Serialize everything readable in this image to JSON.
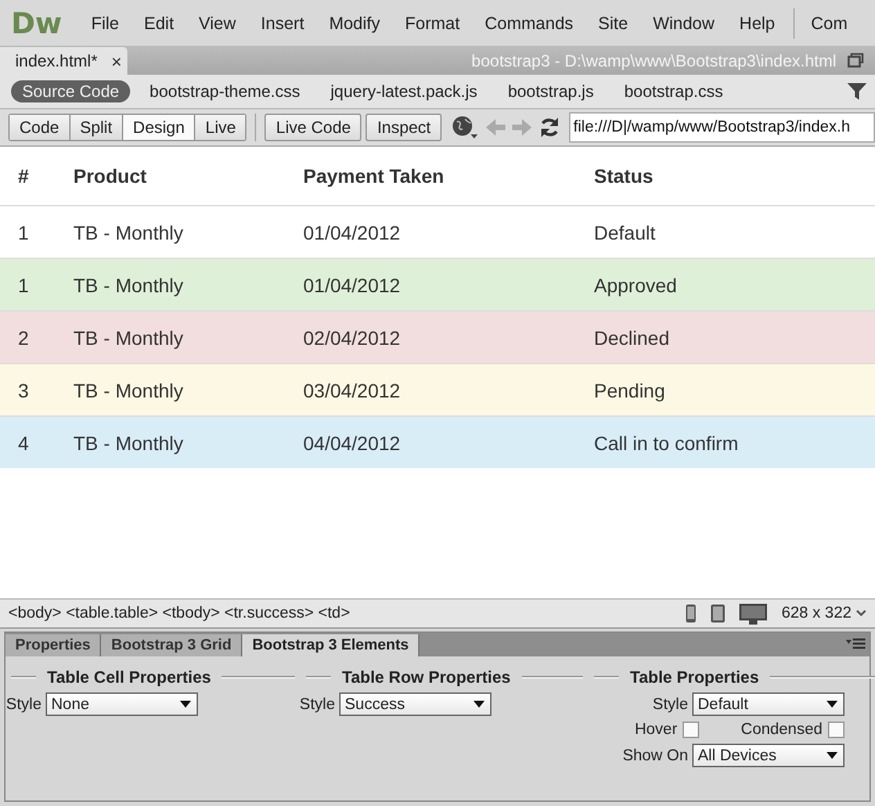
{
  "menu": {
    "logo": "Dw",
    "items": [
      "File",
      "Edit",
      "View",
      "Insert",
      "Modify",
      "Format",
      "Commands",
      "Site",
      "Window",
      "Help"
    ],
    "overflow": "Com"
  },
  "document_tab": {
    "title": "index.html*",
    "close": "×",
    "path": "bootstrap3 - D:\\wamp\\www\\Bootstrap3\\index.html"
  },
  "related_files": [
    {
      "label": "Source Code",
      "selected": true
    },
    {
      "label": "bootstrap-theme.css",
      "selected": false
    },
    {
      "label": "jquery-latest.pack.js",
      "selected": false
    },
    {
      "label": "bootstrap.js",
      "selected": false
    },
    {
      "label": "bootstrap.css",
      "selected": false
    }
  ],
  "toolbar": {
    "views": [
      {
        "label": "Code",
        "selected": false
      },
      {
        "label": "Split",
        "selected": false
      },
      {
        "label": "Design",
        "selected": true
      },
      {
        "label": "Live",
        "selected": false
      }
    ],
    "buttons": [
      "Live Code",
      "Inspect"
    ],
    "address": "file:///D|/wamp/www/Bootstrap3/index.h"
  },
  "table": {
    "columns": [
      "#",
      "Product",
      "Payment Taken",
      "Status"
    ],
    "rows": [
      {
        "kind": "default",
        "cells": [
          "1",
          "TB - Monthly",
          "01/04/2012",
          "Default"
        ]
      },
      {
        "kind": "success",
        "cells": [
          "1",
          "TB - Monthly",
          "01/04/2012",
          "Approved"
        ]
      },
      {
        "kind": "danger",
        "cells": [
          "2",
          "TB - Monthly",
          "02/04/2012",
          "Declined"
        ]
      },
      {
        "kind": "warning",
        "cells": [
          "3",
          "TB - Monthly",
          "03/04/2012",
          "Pending"
        ]
      },
      {
        "kind": "info",
        "cells": [
          "4",
          "TB - Monthly",
          "04/04/2012",
          "Call in to confirm"
        ]
      }
    ]
  },
  "status_bar": {
    "tag_path": "<body> <table.table> <tbody> <tr.success> <td>",
    "window_size": "628 x 322"
  },
  "panel": {
    "tabs": [
      {
        "label": "Properties",
        "selected": false
      },
      {
        "label": "Bootstrap 3 Grid",
        "selected": false
      },
      {
        "label": "Bootstrap 3 Elements",
        "selected": true
      }
    ],
    "sections": [
      {
        "title": "Table Cell Properties",
        "fields": [
          {
            "kind": "select",
            "label": "Style",
            "value": "None"
          }
        ]
      },
      {
        "title": "Table Row Properties",
        "fields": [
          {
            "kind": "select",
            "label": "Style",
            "value": "Success"
          }
        ]
      },
      {
        "title": "Table Properties",
        "fields": [
          {
            "kind": "select",
            "label": "Style",
            "value": "Default"
          },
          {
            "kind": "checks",
            "items": [
              {
                "label": "Hover",
                "checked": false
              },
              {
                "label": "Condensed",
                "checked": false
              }
            ]
          },
          {
            "kind": "select",
            "label": "Show On",
            "value": "All Devices"
          }
        ]
      }
    ]
  }
}
